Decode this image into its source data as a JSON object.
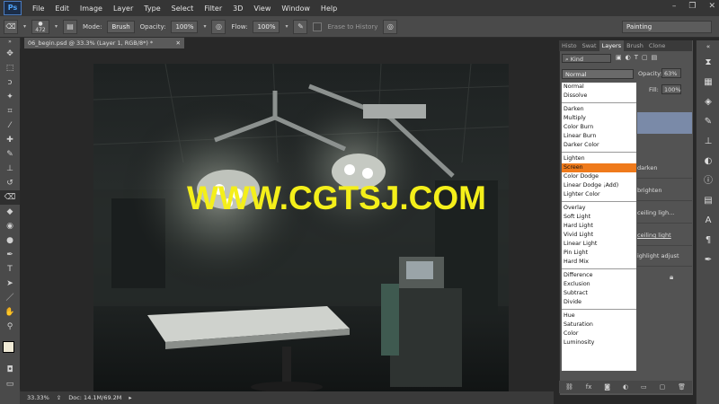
{
  "app": {
    "logo": "Ps"
  },
  "menu": [
    "File",
    "Edit",
    "Image",
    "Layer",
    "Type",
    "Select",
    "Filter",
    "3D",
    "View",
    "Window",
    "Help"
  ],
  "window_controls": {
    "minimize": "–",
    "restore": "❐",
    "close": "✕"
  },
  "options_bar": {
    "brush_size": "472",
    "mode_label": "Mode:",
    "mode_value": "Brush",
    "opacity_label": "Opacity:",
    "opacity_value": "100%",
    "flow_label": "Flow:",
    "flow_value": "100%",
    "erase_history_label": "Erase to History",
    "workspace": "Painting"
  },
  "document": {
    "tab_title": "06_begin.psd @ 33.3% (Layer 1, RGB/8*) *",
    "zoom": "33.33%",
    "doc_info": "Doc: 14.1M/69.2M"
  },
  "panel_tabs": [
    "Histo",
    "Swat",
    "Layers",
    "Brush",
    "Clone"
  ],
  "active_panel_tab": "Layers",
  "layers_panel": {
    "filter_kind": "Kind",
    "blend_mode": "Normal",
    "opacity_label": "Opacity:",
    "opacity_value": "63%",
    "fill_label": "Fill:",
    "fill_value": "100%",
    "layers": [
      "darken",
      "brighten",
      "ceiling ligh...",
      "ceiling light",
      "ighlight adjust"
    ]
  },
  "blend_modes": {
    "groups": [
      [
        "Normal",
        "Dissolve"
      ],
      [
        "Darken",
        "Multiply",
        "Color Burn",
        "Linear Burn",
        "Darker Color"
      ],
      [
        "Lighten",
        "Screen",
        "Color Dodge",
        "Linear Dodge (Add)",
        "Lighter Color"
      ],
      [
        "Overlay",
        "Soft Light",
        "Hard Light",
        "Vivid Light",
        "Linear Light",
        "Pin Light",
        "Hard Mix"
      ],
      [
        "Difference",
        "Exclusion",
        "Subtract",
        "Divide"
      ],
      [
        "Hue",
        "Saturation",
        "Color",
        "Luminosity"
      ]
    ],
    "highlighted": "Screen"
  },
  "watermark": "WWW.CGTSJ.COM",
  "colors": {
    "highlight": "#ef7a1b",
    "watermark": "#f4ef1a",
    "selected_layer": "#7a8aa8"
  }
}
